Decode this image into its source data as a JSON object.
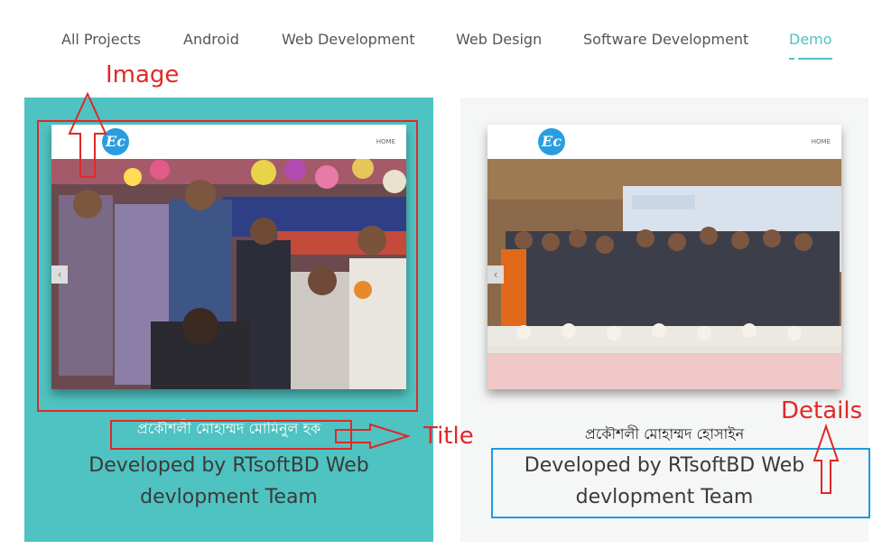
{
  "tabs": [
    {
      "label": "All Projects"
    },
    {
      "label": "Android"
    },
    {
      "label": "Web Development"
    },
    {
      "label": "Web Design"
    },
    {
      "label": "Software Development"
    },
    {
      "label": "Demo",
      "active": true
    }
  ],
  "projects": [
    {
      "logo": "Ec",
      "nav_home": "HOME",
      "prev_arrow": "‹",
      "title": "প্রকৌশলী মোহাম্মদ মোমিনুল হক",
      "details": "Developed by RTsoftBD Web devlopment Team"
    },
    {
      "logo": "Ec",
      "nav_home": "HOME",
      "prev_arrow": "‹",
      "title": "প্রকৌশলী মোহাম্মদ হোসাইন",
      "details": "Developed by RTsoftBD Web devlopment Team"
    }
  ],
  "annotations": {
    "image": "Image",
    "title": "Title",
    "details": "Details"
  },
  "colors": {
    "accent": "#4fc3c1",
    "annotation_red": "#e02828",
    "annotation_blue": "#1e9be0"
  }
}
